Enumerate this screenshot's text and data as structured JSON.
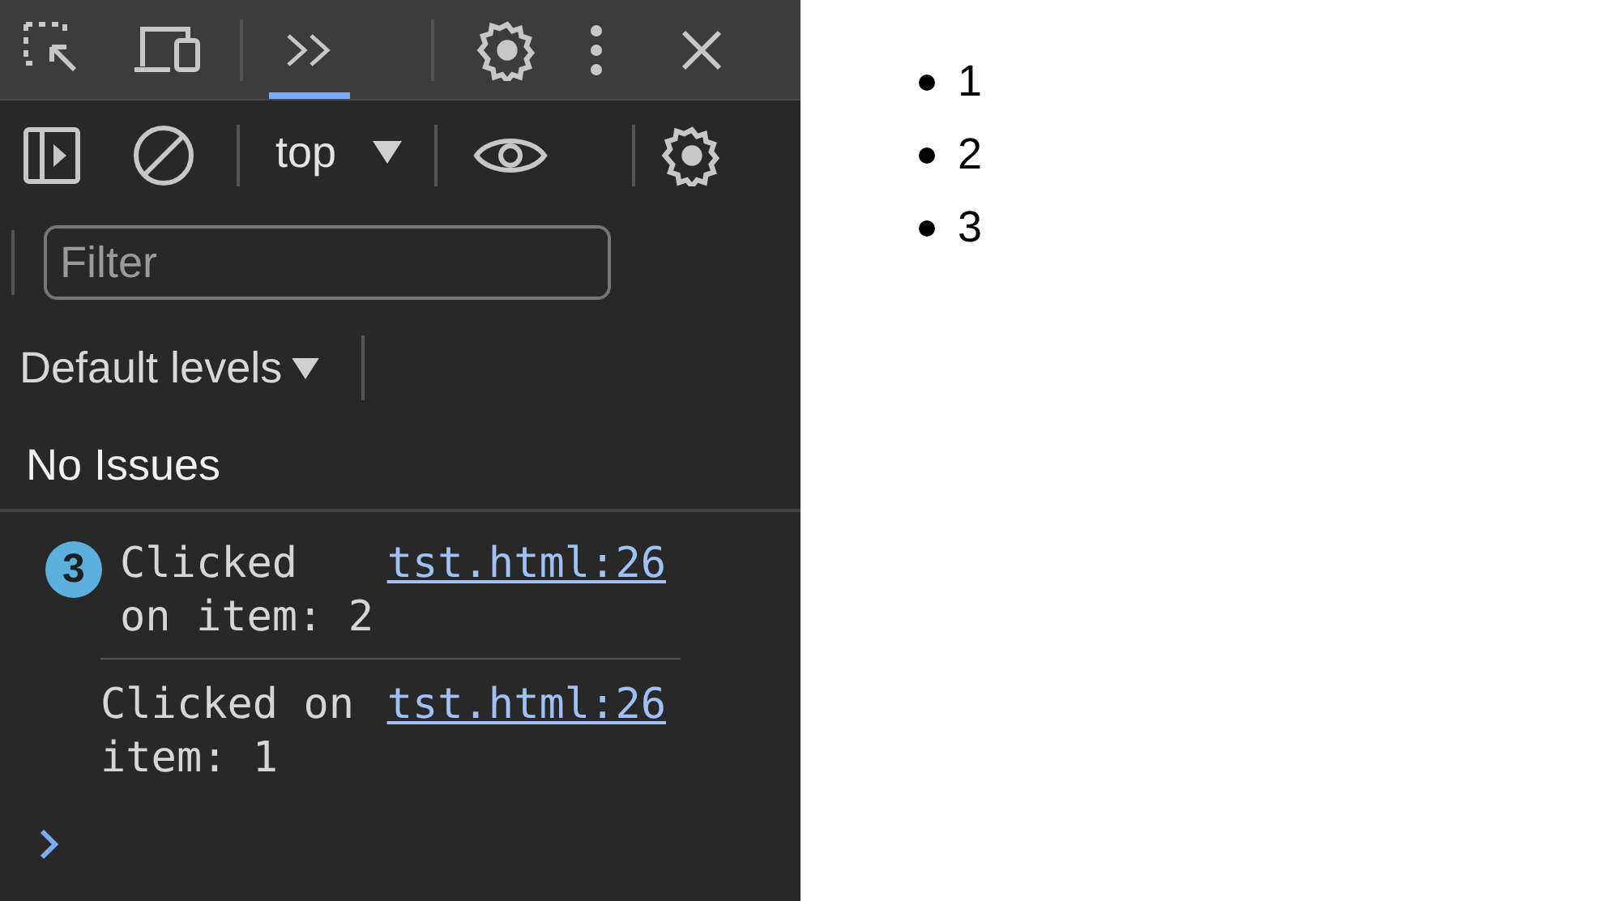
{
  "toolbar": {
    "panel_tabs": [
      {
        "kind": "more",
        "selected": true
      }
    ]
  },
  "console_toolbar": {
    "context": "top",
    "filter": {
      "placeholder": "Filter"
    },
    "levels": "Default levels"
  },
  "issues": "No Issues",
  "messages": [
    {
      "text": "Clicked on item: 2",
      "source": "tst.html:26",
      "count": "3"
    },
    {
      "text": "Clicked on item: 1",
      "source": "tst.html:26"
    }
  ],
  "page": {
    "list": [
      "1",
      "2",
      "3"
    ]
  }
}
